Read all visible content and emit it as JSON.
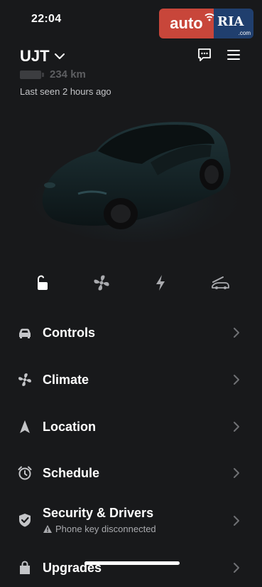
{
  "status_bar": {
    "time": "22:04"
  },
  "watermark": {
    "left": "auto",
    "right": "RIA",
    "domain": ".com"
  },
  "header": {
    "car_name": "UJT",
    "range": "234 km",
    "last_seen": "Last seen 2 hours ago"
  },
  "quick_actions": [
    {
      "name": "unlock",
      "icon": "unlock-icon"
    },
    {
      "name": "climate",
      "icon": "fan-icon"
    },
    {
      "name": "charge",
      "icon": "lightning-icon"
    },
    {
      "name": "frunk",
      "icon": "frunk-icon"
    }
  ],
  "menu": {
    "items": [
      {
        "label": "Controls",
        "icon": "car-icon"
      },
      {
        "label": "Climate",
        "icon": "fan-icon"
      },
      {
        "label": "Location",
        "icon": "location-arrow-icon"
      },
      {
        "label": "Schedule",
        "icon": "alarm-clock-icon"
      },
      {
        "label": "Security & Drivers",
        "icon": "shield-check-icon",
        "sublabel": "Phone key disconnected"
      },
      {
        "label": "Upgrades",
        "icon": "bag-icon"
      }
    ]
  },
  "colors": {
    "background": "#18191b",
    "text": "#ffffff",
    "muted": "#a9aaae",
    "watermark_red": "#c8463a",
    "watermark_blue": "#203f6e"
  }
}
